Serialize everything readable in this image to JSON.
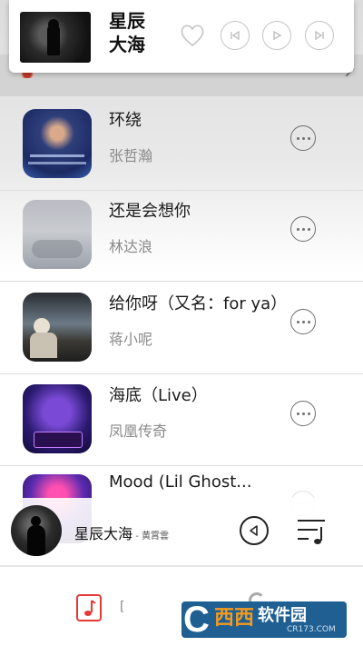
{
  "floating_player": {
    "title": "星辰\n大海",
    "title_line1": "星辰",
    "title_line2": "大海",
    "icons": [
      "heart-icon",
      "previous-icon",
      "play-icon",
      "next-icon"
    ]
  },
  "songs": [
    {
      "title": "环绕",
      "artist": "张哲瀚"
    },
    {
      "title": "还是会想你",
      "artist": "林达浪"
    },
    {
      "title": "给你呀（又名：for ya）",
      "artist": "蒋小呢"
    },
    {
      "title": "海底（Live）",
      "artist": "凤凰传奇"
    },
    {
      "title": "Mood (Lil Ghost...",
      "artist": ""
    }
  ],
  "mini_player": {
    "title": "星辰大海",
    "artist": " - 黄霄雲"
  },
  "bottom_nav": {
    "label": "[",
    "icons": [
      "music-note-icon",
      "loading-icon"
    ]
  },
  "watermark": {
    "brand": "西西",
    "sub": "软件园",
    "url": "CR173.COM"
  }
}
